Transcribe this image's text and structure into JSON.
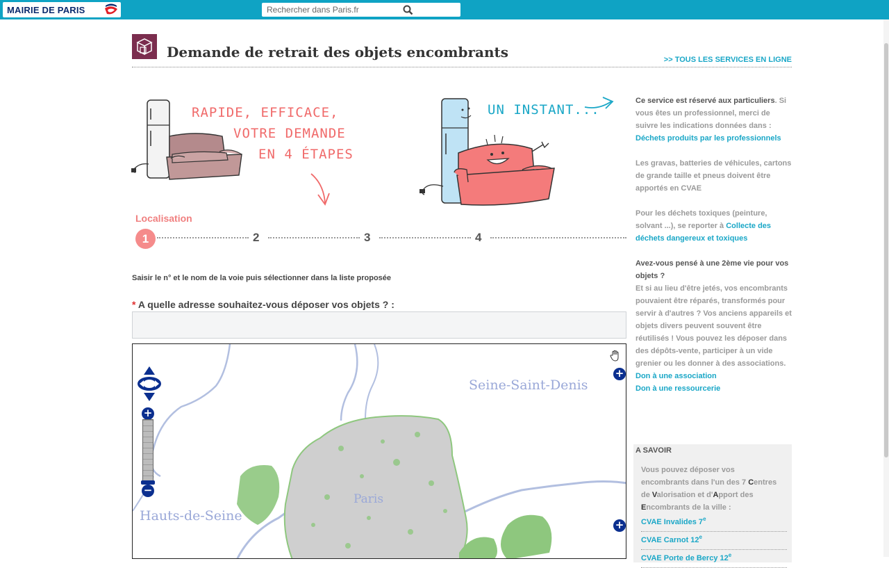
{
  "topbar": {
    "logo_text": "MAIRIE DE PARIS",
    "search_placeholder": "Recherher dans Paris.fr",
    "search_value": "Rechercher dans Paris.fr"
  },
  "header": {
    "title": "Demande de retrait des objets encombrants",
    "all_services": ">> TOUS LES SERVICES EN LIGNE"
  },
  "illustration": {
    "left_line1": "RAPIDE, EFFICACE,",
    "left_line2": "VOTRE DEMANDE",
    "left_line3": "EN 4 ÉTAPES",
    "right_text": "UN INSTANT..."
  },
  "steps": {
    "current_label": "Localisation",
    "items": [
      "1",
      "2",
      "3",
      "4"
    ]
  },
  "form": {
    "instruction": "Saisir le n° et le nom de la voie puis sélectionner dans la liste proposée",
    "required_mark": "*",
    "question": "A quelle adresse souhaitez-vous déposer vos objets ? :",
    "address_value": ""
  },
  "map": {
    "labels": [
      "Seine-Saint-Denis",
      "Paris",
      "Hauts-de-Seine"
    ],
    "colors": {
      "water": "#b2bfe0",
      "urban": "#c9c9c9",
      "green": "#8ec77e",
      "control": "#0b2f8f"
    }
  },
  "sidebar": {
    "p1_dark": "Ce service est réservé aux particuliers",
    "p1_light": ". Si vous êtes un professionnel, merci de suivre les indications données dans : ",
    "p1_link": "Déchets produits par les professionnels",
    "p2": "Les gravas, batteries de véhicules, cartons de grande taille et pneus doivent être apportés en CVAE",
    "p3_light": "Pour les déchets toxiques (peinture, solvant ...), se reporter à ",
    "p3_link": "Collecte des déchets dangereux et toxiques",
    "p4_dark": "Avez-vous pensé à une 2ème vie pour vos objets ?",
    "p4_light": "Et si au lieu d'être jetés, vos encombrants pouvaient être réparés, transformés pour servir à d'autres ? Vos anciens appareils et objets divers peuvent souvent être réutilisés ! Vous pouvez les déposer dans des dépôts-vente, participer à un vide grenier ou les donner à des associations.",
    "link_association": "Don à une association",
    "link_ressourcerie": "Don à une ressourcerie"
  },
  "savoir": {
    "title": "A SAVOIR",
    "text_a": "Vous pouvez déposer vos encombrants dans l'un des 7 ",
    "c": "C",
    "text_b": "entres de ",
    "v": "V",
    "text_c": "alorisation et d'",
    "a": "A",
    "text_d": "pport des ",
    "e": "E",
    "text_e": "ncombrants de la ville :",
    "links": [
      {
        "label": "CVAE Invalides 7",
        "sup": "e"
      },
      {
        "label": "CVAE Carnot 12",
        "sup": "e"
      },
      {
        "label": "CVAE Porte de Bercy 12",
        "sup": "e"
      }
    ]
  }
}
